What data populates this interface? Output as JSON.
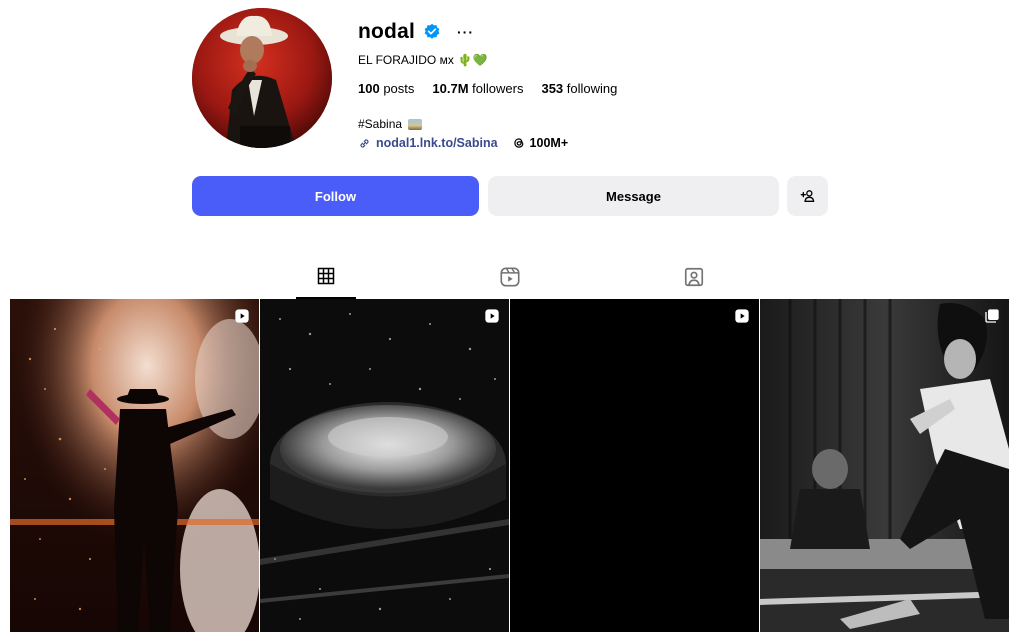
{
  "profile": {
    "username": "nodal",
    "more_label": "···",
    "full_name": "EL FORAJIDO ᴍx",
    "full_name_emojis": "🌵💚",
    "verified": true
  },
  "stats": {
    "posts_count": "100",
    "posts_label": "posts",
    "followers_count": "10.7M",
    "followers_label": "followers",
    "following_count": "353",
    "following_label": "following"
  },
  "bio": {
    "text": "#Sabina"
  },
  "links": {
    "url_text": "nodal1.lnk.to/Sabina",
    "threads_count": "100M+"
  },
  "actions": {
    "follow_label": "Follow",
    "message_label": "Message"
  },
  "tabs": [
    {
      "name": "posts",
      "icon": "grid-icon",
      "active": true
    },
    {
      "name": "reels",
      "icon": "reels-icon",
      "active": false
    },
    {
      "name": "tagged",
      "icon": "tagged-icon",
      "active": false
    }
  ],
  "posts": [
    {
      "type": "reel",
      "badge_icon": "reel-icon"
    },
    {
      "type": "reel",
      "badge_icon": "reel-icon"
    },
    {
      "type": "reel",
      "badge_icon": "reel-icon"
    },
    {
      "type": "carousel",
      "badge_icon": "carousel-icon"
    }
  ],
  "colors": {
    "follow_button": "#4a5df9",
    "secondary_button": "#efeff2",
    "link": "#3b4a8c",
    "verified": "#0095f6"
  }
}
